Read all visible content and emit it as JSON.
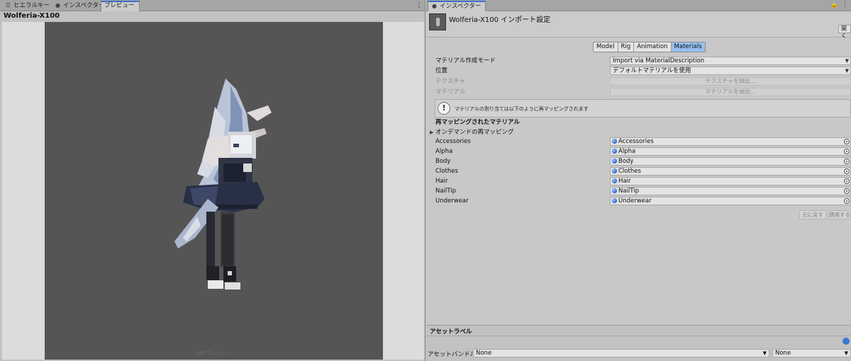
{
  "left_panel": {
    "tabs": [
      {
        "label": "ヒエラルキー",
        "icon": "list-icon"
      },
      {
        "label": "インスペクター",
        "icon": "info-icon"
      },
      {
        "label": "プレビュー",
        "icon": ""
      }
    ],
    "preview_title": "Wolferia-X100",
    "preview_caption": "BKPプレビュー"
  },
  "right_panel": {
    "tab_label": "インスペクター",
    "asset_title": "Wolferia-X100 インポート設定",
    "open_button": "開く",
    "import_tabs": [
      "Model",
      "Rig",
      "Animation",
      "Materials"
    ],
    "selected_tab": "Materials",
    "material_creation_mode": {
      "label": "マテリアル作成モード",
      "value": "Import via MaterialDescription"
    },
    "location": {
      "label": "位置",
      "value": "デフォルトマテリアルを使用"
    },
    "textures": {
      "label": "テクスチャ",
      "button": "テクスチャを抽出..."
    },
    "materials": {
      "label": "マテリアル",
      "button": "マテリアルを抽出..."
    },
    "info_message": "マテリアルの割り当ては以下のように再マッピングされます",
    "remapped_header": "再マッピングされたマテリアル",
    "on_demand_label": "オンデマンドの再マッピング",
    "remap_rows": [
      {
        "name": "Accessories",
        "value": "Accessories"
      },
      {
        "name": "Alpha",
        "value": "Alpha"
      },
      {
        "name": "Body",
        "value": "Body"
      },
      {
        "name": "Clothes",
        "value": "Clothes"
      },
      {
        "name": "Hair",
        "value": "Hair"
      },
      {
        "name": "NailTip",
        "value": "NailTip"
      },
      {
        "name": "Underwear",
        "value": "Underwear"
      }
    ],
    "revert_button": "元に戻す",
    "apply_button": "適用する",
    "asset_labels_title": "アセットラベル",
    "asset_bundle_label": "アセットバンドル",
    "asset_bundle_value": "None",
    "asset_variant_value": "None"
  },
  "colors": {
    "selected_tab": "#96c0ef",
    "accent": "#3a72c8",
    "preview_bg": "#555555"
  }
}
